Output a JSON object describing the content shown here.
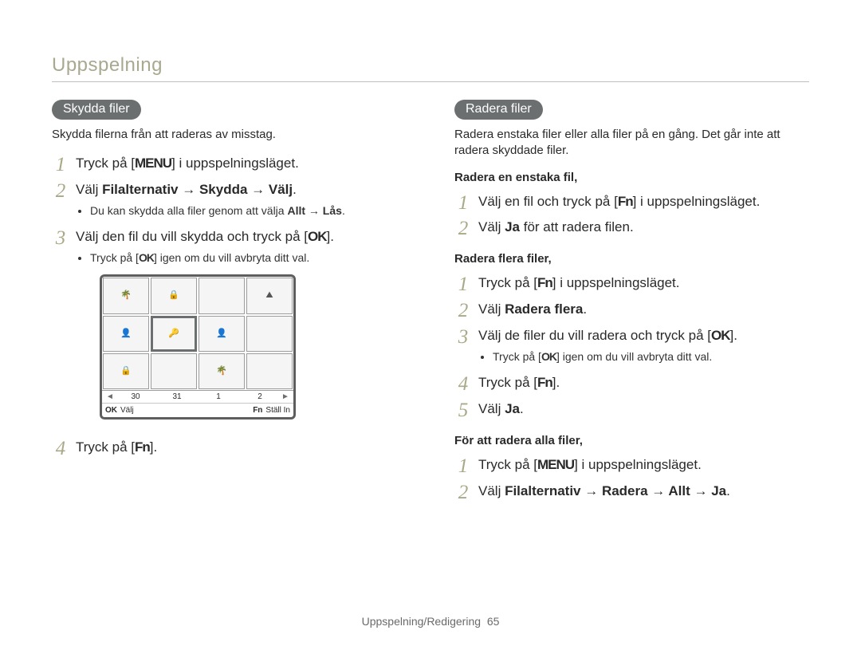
{
  "header": "Uppspelning",
  "footer": {
    "text": "Uppspelning/Redigering",
    "page": "65"
  },
  "left": {
    "pill": "Skydda filer",
    "intro": "Skydda filerna från att raderas av misstag.",
    "step1": {
      "a": "Tryck på [",
      "key": "MENU",
      "b": "] i uppspelningsläget."
    },
    "step2": {
      "a": "Välj ",
      "strong": "Filalternativ → Skydda → Välj",
      "b": "."
    },
    "step2_bullet": {
      "a": "Du kan skydda alla filer genom att välja ",
      "strong": "Allt → Lås",
      "b": "."
    },
    "step3": {
      "a": "Välj den fil du vill skydda och tryck på [",
      "key": "OK",
      "b": "]."
    },
    "step3_bullet": {
      "a": "Tryck på [",
      "key": "OK",
      "b": "] igen om du vill avbryta ditt val."
    },
    "step4": {
      "a": "Tryck på [",
      "key": "Fn",
      "b": "]."
    },
    "camera": {
      "dates": [
        "30",
        "31",
        "1",
        "2"
      ],
      "bar": {
        "okKey": "OK",
        "okLabel": "Välj",
        "fnKey": "Fn",
        "fnLabel": "Ställ In"
      }
    }
  },
  "right": {
    "pill": "Radera filer",
    "intro": "Radera enstaka filer eller alla filer på en gång. Det går inte att radera skyddade filer.",
    "h_single": "Radera en enstaka fil,",
    "single1": {
      "a": "Välj en fil och tryck på [",
      "key": "Fn",
      "b": "] i uppspelningsläget."
    },
    "single2": {
      "a": "Välj ",
      "strong": "Ja",
      "b": " för att radera filen."
    },
    "h_multi": "Radera flera filer,",
    "multi1": {
      "a": "Tryck på [",
      "key": "Fn",
      "b": "] i uppspelningsläget."
    },
    "multi2": {
      "a": "Välj ",
      "strong": "Radera flera",
      "b": "."
    },
    "multi3": {
      "a": "Välj de filer du vill radera och tryck på [",
      "key": "OK",
      "b": "]."
    },
    "multi3_bullet": {
      "a": "Tryck på [",
      "key": "OK",
      "b": "] igen om du vill avbryta ditt val."
    },
    "multi4": {
      "a": "Tryck på [",
      "key": "Fn",
      "b": "]."
    },
    "multi5": {
      "a": "Välj ",
      "strong": "Ja",
      "b": "."
    },
    "h_all": "För att radera alla filer,",
    "all1": {
      "a": "Tryck på [",
      "key": "MENU",
      "b": "] i uppspelningsläget."
    },
    "all2": {
      "a": "Välj ",
      "strong": "Filalternativ → Radera → Allt → Ja",
      "b": "."
    }
  }
}
